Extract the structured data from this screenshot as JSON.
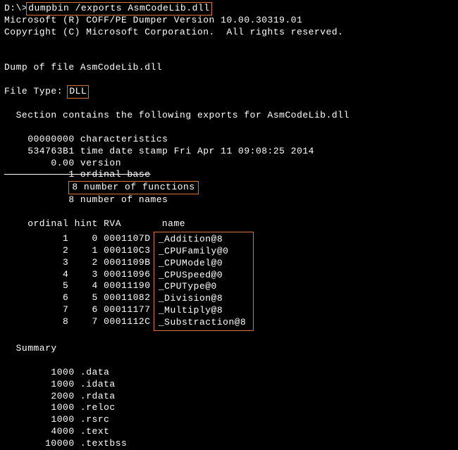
{
  "prompt": "D:\\>",
  "command": "dumpbin /exports AsmCodeLib.dll",
  "banner1": "Microsoft (R) COFF/PE Dumper Version 10.00.30319.01",
  "banner2": "Copyright (C) Microsoft Corporation.  All rights reserved.",
  "dump_line": "Dump of file AsmCodeLib.dll",
  "filetype_label": "File Type: ",
  "filetype_value": "DLL",
  "section_line": "  Section contains the following exports for AsmCodeLib.dll",
  "chars": "    00000000 characteristics",
  "timestamp": "    534763B1 time date stamp Fri Apr 11 09:08:25 2014",
  "version": "        0.00 version",
  "ordinal_base": "           1 ordinal base",
  "num_funcs_pre": "           ",
  "num_funcs": "8 number of functions",
  "num_names": "           8 number of names",
  "header_left": "    ordinal hint RVA      ",
  "header_name": "name",
  "rows_left": [
    "          1    0 0001107D",
    "          2    1 000110C3",
    "          3    2 0001109B",
    "          4    3 00011096",
    "          5    4 00011190",
    "          6    5 00011082",
    "          7    6 00011177",
    "          8    7 0001112C"
  ],
  "rows_name": [
    "_Addition@8",
    "_CPUFamily@0",
    "_CPUModel@0",
    "_CPUSpeed@0",
    "_CPUType@0",
    "_Division@8",
    "_Multiply@8",
    "_Substraction@8"
  ],
  "summary_label": "  Summary",
  "summary": [
    "        1000 .data",
    "        1000 .idata",
    "        2000 .rdata",
    "        1000 .reloc",
    "        1000 .rsrc",
    "        4000 .text",
    "       10000 .textbss"
  ],
  "chart_data": {
    "type": "table",
    "title": "dumpbin /exports AsmCodeLib.dll",
    "columns": [
      "ordinal",
      "hint",
      "RVA",
      "name"
    ],
    "rows": [
      [
        1,
        0,
        "0001107D",
        "_Addition@8"
      ],
      [
        2,
        1,
        "000110C3",
        "_CPUFamily@0"
      ],
      [
        3,
        2,
        "0001109B",
        "_CPUModel@0"
      ],
      [
        4,
        3,
        "00011096",
        "_CPUSpeed@0"
      ],
      [
        5,
        4,
        "00011190",
        "_CPUType@0"
      ],
      [
        6,
        5,
        "00011082",
        "_Division@8"
      ],
      [
        7,
        6,
        "00011177",
        "_Multiply@8"
      ],
      [
        8,
        7,
        "0001112C",
        "_Substraction@8"
      ]
    ]
  }
}
